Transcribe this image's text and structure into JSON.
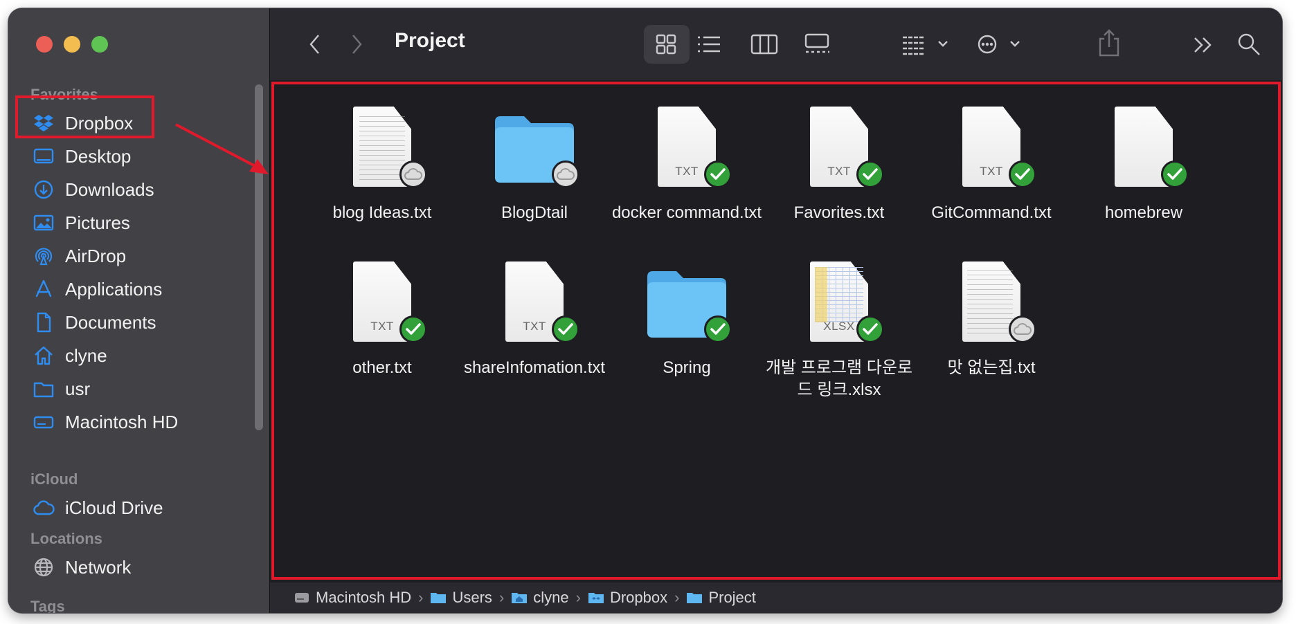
{
  "window": {
    "title": "Project"
  },
  "sidebar": {
    "sections": {
      "favorites": "Favorites",
      "icloud": "iCloud",
      "locations": "Locations",
      "tags": "Tags"
    },
    "favorites": [
      {
        "label": "Dropbox",
        "icon": "dropbox-icon"
      },
      {
        "label": "Desktop",
        "icon": "desktop-icon"
      },
      {
        "label": "Downloads",
        "icon": "downloads-icon"
      },
      {
        "label": "Pictures",
        "icon": "pictures-icon"
      },
      {
        "label": "AirDrop",
        "icon": "airdrop-icon"
      },
      {
        "label": "Applications",
        "icon": "applications-icon"
      },
      {
        "label": "Documents",
        "icon": "document-icon"
      },
      {
        "label": "clyne",
        "icon": "home-icon"
      },
      {
        "label": "usr",
        "icon": "folder-icon"
      },
      {
        "label": "Macintosh HD",
        "icon": "drive-icon"
      }
    ],
    "icloud": [
      {
        "label": "iCloud Drive",
        "icon": "cloud-icon"
      }
    ],
    "locations": [
      {
        "label": "Network",
        "icon": "globe-icon"
      }
    ]
  },
  "files": [
    {
      "name": "blog Ideas.txt",
      "kind": "text-preview",
      "status": "cloud"
    },
    {
      "name": "BlogDtail",
      "kind": "folder",
      "status": "cloud"
    },
    {
      "name": "docker command.txt",
      "kind": "txt",
      "type_label": "TXT",
      "status": "synced"
    },
    {
      "name": "Favorites.txt",
      "kind": "txt",
      "type_label": "TXT",
      "status": "synced"
    },
    {
      "name": "GitCommand.txt",
      "kind": "txt",
      "type_label": "TXT",
      "status": "synced"
    },
    {
      "name": "homebrew",
      "kind": "blank",
      "status": "synced"
    },
    {
      "name": "other.txt",
      "kind": "txt",
      "type_label": "TXT",
      "status": "synced"
    },
    {
      "name": "shareInfomation.txt",
      "kind": "txt",
      "type_label": "TXT",
      "status": "synced"
    },
    {
      "name": "Spring",
      "kind": "folder",
      "status": "synced"
    },
    {
      "name": "개발 프로그램 다운로드 링크.xlsx",
      "kind": "xlsx",
      "type_label": "XLSX",
      "status": "synced"
    },
    {
      "name": "맛 없는집.txt",
      "kind": "text-preview",
      "status": "cloud"
    }
  ],
  "pathbar": [
    {
      "label": "Macintosh HD",
      "icon": "drive-icon"
    },
    {
      "label": "Users",
      "icon": "folder-icon"
    },
    {
      "label": "clyne",
      "icon": "home-folder-icon"
    },
    {
      "label": "Dropbox",
      "icon": "dropbox-folder-icon"
    },
    {
      "label": "Project",
      "icon": "folder-icon"
    }
  ],
  "colors": {
    "annotation": "#e0192b",
    "folder": "#6cc3f5",
    "sync_badge": "#32a13a",
    "sidebar_icon": "#2f8cf0"
  }
}
